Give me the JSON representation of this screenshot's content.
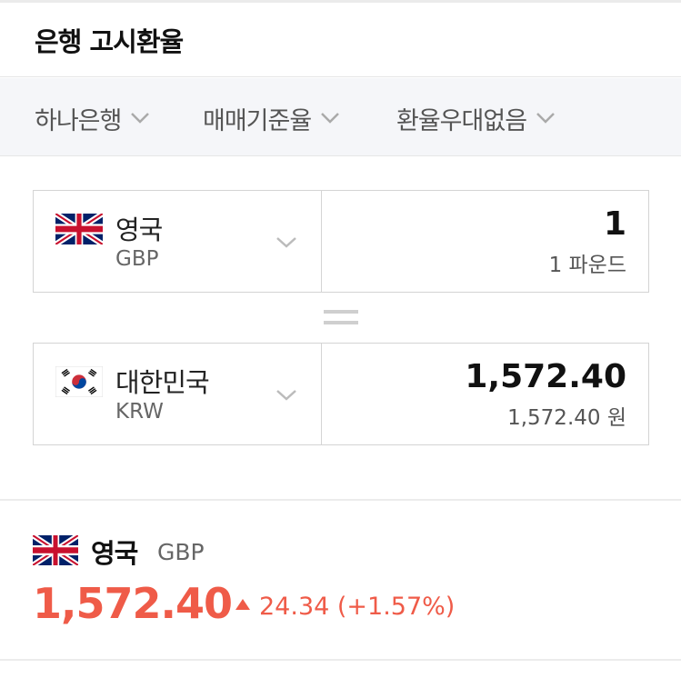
{
  "header": {
    "title": "은행 고시환율"
  },
  "filters": [
    {
      "label": "하나은행",
      "icon": "chevron-down-icon"
    },
    {
      "label": "매매기준율",
      "icon": "chevron-down-icon"
    },
    {
      "label": "환율우대없음",
      "icon": "chevron-down-icon"
    }
  ],
  "converter": {
    "from": {
      "country": "영국",
      "code": "GBP",
      "amount": "1",
      "amount_text": "1 파운드",
      "flag": "uk-flag-icon"
    },
    "to": {
      "country": "대한민국",
      "code": "KRW",
      "amount": "1,572.40",
      "amount_text": "1,572.40 원",
      "flag": "korea-flag-icon"
    }
  },
  "summary": {
    "country": "영국",
    "code": "GBP",
    "rate": "1,572.40",
    "change": "24.34 (+1.57%)",
    "direction": "up",
    "up_color": "#ef5b48"
  }
}
